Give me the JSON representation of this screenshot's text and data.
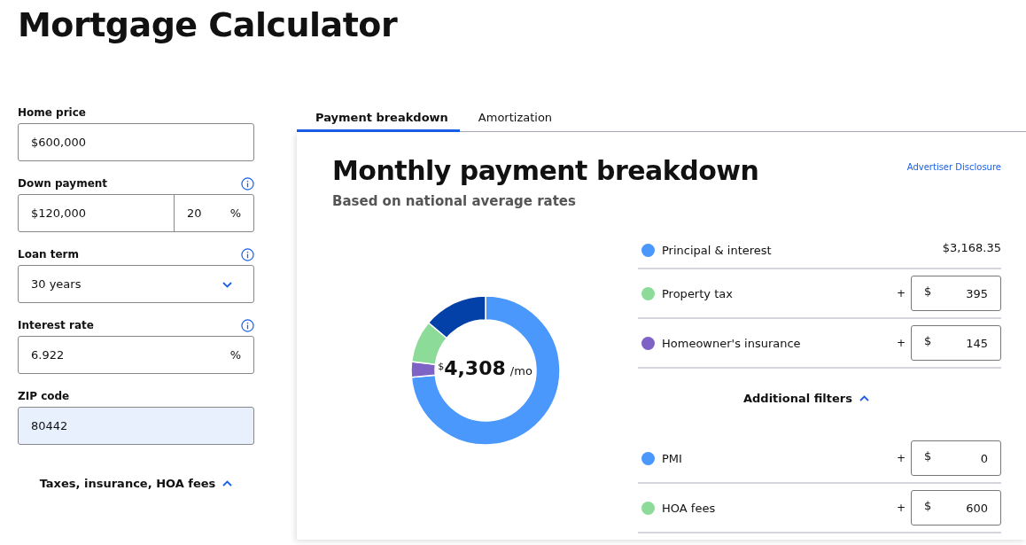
{
  "page_title": "Mortgage Calculator",
  "form": {
    "fields": [
      {
        "kind": "text",
        "label": "Home price",
        "value": "$600,000",
        "info": false,
        "highlighted": false
      },
      {
        "kind": "split",
        "label": "Down payment",
        "value": "$120,000",
        "percent": "20",
        "unit": "%",
        "info": true,
        "highlighted": false
      },
      {
        "kind": "select",
        "label": "Loan term",
        "value": "30 years",
        "info": true,
        "highlighted": false
      },
      {
        "kind": "unit",
        "label": "Interest rate",
        "value": "6.922",
        "unit": "%",
        "info": true,
        "highlighted": false
      },
      {
        "kind": "text",
        "label": "ZIP code",
        "value": "80442",
        "info": false,
        "highlighted": true
      }
    ],
    "toggle": {
      "label": "Taxes, insurance, HOA fees",
      "expanded": true
    }
  },
  "tabs": [
    {
      "label": "Payment breakdown",
      "selected": true
    },
    {
      "label": "Amortization",
      "selected": false
    }
  ],
  "panel": {
    "title": "Monthly payment breakdown",
    "subtitle": "Based on national average rates",
    "disclosure": "Advertiser Disclosure",
    "total": {
      "currency": "$",
      "amount": "4,308",
      "unit": "/mo"
    },
    "chart_data": {
      "type": "donut",
      "values": [
        73.53,
        3.37,
        9.17,
        13.93
      ],
      "colors": [
        "#4a98fb",
        "#7e62c6",
        "#8ddb98",
        "#0340a8"
      ]
    },
    "rows": [
      {
        "kind": "amount",
        "label": "Principal & interest",
        "color": "#4a98fb",
        "value": "$3,168.35"
      },
      {
        "kind": "input",
        "label": "Property tax",
        "color": "#8ddb98",
        "sign": "+",
        "currency": "$",
        "value": "395"
      },
      {
        "kind": "input",
        "label": "Homeowner's insurance",
        "color": "#7e62c6",
        "sign": "+",
        "currency": "$",
        "value": "145"
      }
    ],
    "filters_toggle": {
      "label": "Additional filters",
      "expanded": true
    },
    "extra_rows": [
      {
        "kind": "input",
        "label": "PMI",
        "color": "#4a98fb",
        "sign": "+",
        "currency": "$",
        "value": "0"
      },
      {
        "kind": "input",
        "label": "HOA fees",
        "color": "#8ddb98",
        "sign": "+",
        "currency": "$",
        "value": "600"
      }
    ]
  }
}
